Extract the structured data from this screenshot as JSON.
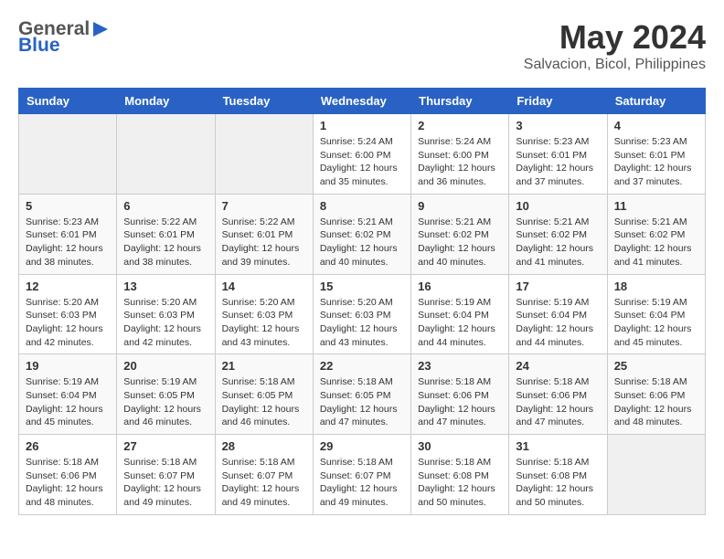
{
  "header": {
    "logo_general": "General",
    "logo_blue": "Blue",
    "title": "May 2024",
    "subtitle": "Salvacion, Bicol, Philippines"
  },
  "columns": [
    "Sunday",
    "Monday",
    "Tuesday",
    "Wednesday",
    "Thursday",
    "Friday",
    "Saturday"
  ],
  "weeks": [
    [
      {
        "day": "",
        "info": ""
      },
      {
        "day": "",
        "info": ""
      },
      {
        "day": "",
        "info": ""
      },
      {
        "day": "1",
        "info": "Sunrise: 5:24 AM\nSunset: 6:00 PM\nDaylight: 12 hours\nand 35 minutes."
      },
      {
        "day": "2",
        "info": "Sunrise: 5:24 AM\nSunset: 6:00 PM\nDaylight: 12 hours\nand 36 minutes."
      },
      {
        "day": "3",
        "info": "Sunrise: 5:23 AM\nSunset: 6:01 PM\nDaylight: 12 hours\nand 37 minutes."
      },
      {
        "day": "4",
        "info": "Sunrise: 5:23 AM\nSunset: 6:01 PM\nDaylight: 12 hours\nand 37 minutes."
      }
    ],
    [
      {
        "day": "5",
        "info": "Sunrise: 5:23 AM\nSunset: 6:01 PM\nDaylight: 12 hours\nand 38 minutes."
      },
      {
        "day": "6",
        "info": "Sunrise: 5:22 AM\nSunset: 6:01 PM\nDaylight: 12 hours\nand 38 minutes."
      },
      {
        "day": "7",
        "info": "Sunrise: 5:22 AM\nSunset: 6:01 PM\nDaylight: 12 hours\nand 39 minutes."
      },
      {
        "day": "8",
        "info": "Sunrise: 5:21 AM\nSunset: 6:02 PM\nDaylight: 12 hours\nand 40 minutes."
      },
      {
        "day": "9",
        "info": "Sunrise: 5:21 AM\nSunset: 6:02 PM\nDaylight: 12 hours\nand 40 minutes."
      },
      {
        "day": "10",
        "info": "Sunrise: 5:21 AM\nSunset: 6:02 PM\nDaylight: 12 hours\nand 41 minutes."
      },
      {
        "day": "11",
        "info": "Sunrise: 5:21 AM\nSunset: 6:02 PM\nDaylight: 12 hours\nand 41 minutes."
      }
    ],
    [
      {
        "day": "12",
        "info": "Sunrise: 5:20 AM\nSunset: 6:03 PM\nDaylight: 12 hours\nand 42 minutes."
      },
      {
        "day": "13",
        "info": "Sunrise: 5:20 AM\nSunset: 6:03 PM\nDaylight: 12 hours\nand 42 minutes."
      },
      {
        "day": "14",
        "info": "Sunrise: 5:20 AM\nSunset: 6:03 PM\nDaylight: 12 hours\nand 43 minutes."
      },
      {
        "day": "15",
        "info": "Sunrise: 5:20 AM\nSunset: 6:03 PM\nDaylight: 12 hours\nand 43 minutes."
      },
      {
        "day": "16",
        "info": "Sunrise: 5:19 AM\nSunset: 6:04 PM\nDaylight: 12 hours\nand 44 minutes."
      },
      {
        "day": "17",
        "info": "Sunrise: 5:19 AM\nSunset: 6:04 PM\nDaylight: 12 hours\nand 44 minutes."
      },
      {
        "day": "18",
        "info": "Sunrise: 5:19 AM\nSunset: 6:04 PM\nDaylight: 12 hours\nand 45 minutes."
      }
    ],
    [
      {
        "day": "19",
        "info": "Sunrise: 5:19 AM\nSunset: 6:04 PM\nDaylight: 12 hours\nand 45 minutes."
      },
      {
        "day": "20",
        "info": "Sunrise: 5:19 AM\nSunset: 6:05 PM\nDaylight: 12 hours\nand 46 minutes."
      },
      {
        "day": "21",
        "info": "Sunrise: 5:18 AM\nSunset: 6:05 PM\nDaylight: 12 hours\nand 46 minutes."
      },
      {
        "day": "22",
        "info": "Sunrise: 5:18 AM\nSunset: 6:05 PM\nDaylight: 12 hours\nand 47 minutes."
      },
      {
        "day": "23",
        "info": "Sunrise: 5:18 AM\nSunset: 6:06 PM\nDaylight: 12 hours\nand 47 minutes."
      },
      {
        "day": "24",
        "info": "Sunrise: 5:18 AM\nSunset: 6:06 PM\nDaylight: 12 hours\nand 47 minutes."
      },
      {
        "day": "25",
        "info": "Sunrise: 5:18 AM\nSunset: 6:06 PM\nDaylight: 12 hours\nand 48 minutes."
      }
    ],
    [
      {
        "day": "26",
        "info": "Sunrise: 5:18 AM\nSunset: 6:06 PM\nDaylight: 12 hours\nand 48 minutes."
      },
      {
        "day": "27",
        "info": "Sunrise: 5:18 AM\nSunset: 6:07 PM\nDaylight: 12 hours\nand 49 minutes."
      },
      {
        "day": "28",
        "info": "Sunrise: 5:18 AM\nSunset: 6:07 PM\nDaylight: 12 hours\nand 49 minutes."
      },
      {
        "day": "29",
        "info": "Sunrise: 5:18 AM\nSunset: 6:07 PM\nDaylight: 12 hours\nand 49 minutes."
      },
      {
        "day": "30",
        "info": "Sunrise: 5:18 AM\nSunset: 6:08 PM\nDaylight: 12 hours\nand 50 minutes."
      },
      {
        "day": "31",
        "info": "Sunrise: 5:18 AM\nSunset: 6:08 PM\nDaylight: 12 hours\nand 50 minutes."
      },
      {
        "day": "",
        "info": ""
      }
    ]
  ]
}
